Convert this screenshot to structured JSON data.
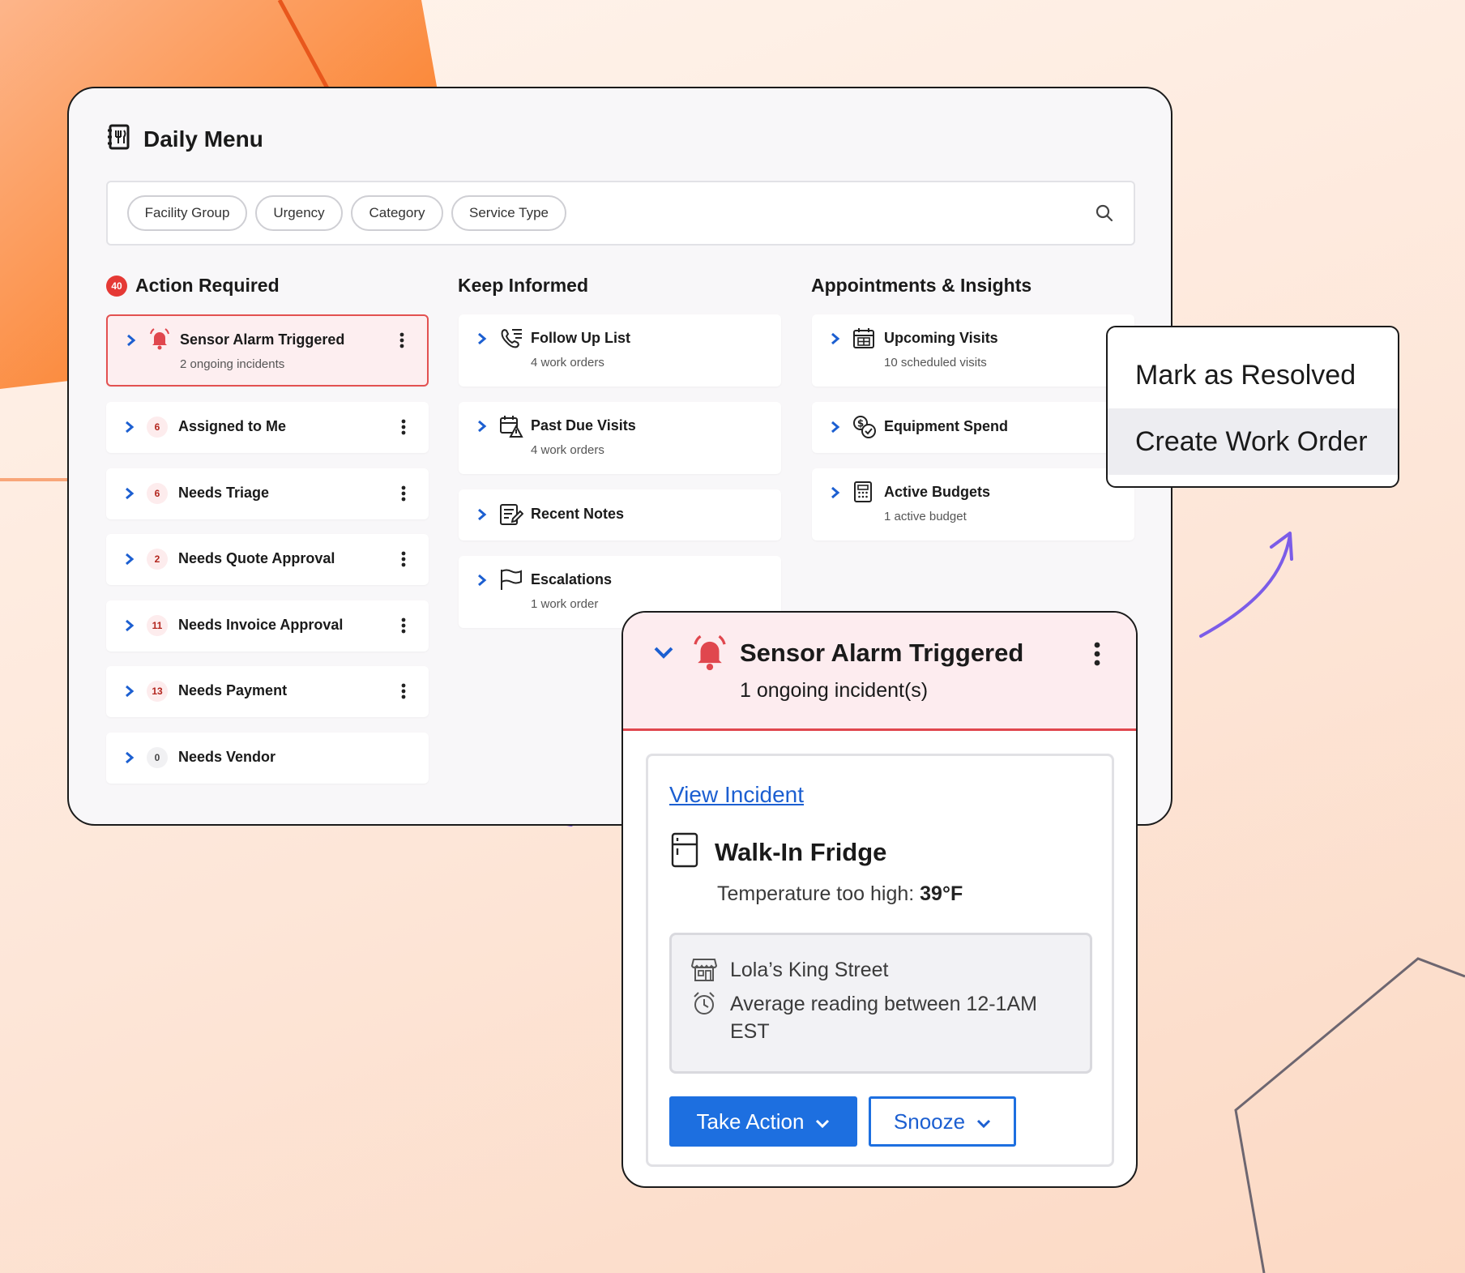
{
  "app": {
    "title": "Daily Menu"
  },
  "filters": [
    "Facility Group",
    "Urgency",
    "Category",
    "Service Type"
  ],
  "sections": {
    "action_required": {
      "title": "Action Required",
      "count": "40",
      "items": [
        {
          "label": "Sensor Alarm Triggered",
          "sub": "2 ongoing incidents"
        },
        {
          "label": "Assigned to Me",
          "count": "6"
        },
        {
          "label": "Needs Triage",
          "count": "6"
        },
        {
          "label": "Needs Quote Approval",
          "count": "2"
        },
        {
          "label": "Needs Invoice Approval",
          "count": "11"
        },
        {
          "label": "Needs Payment",
          "count": "13"
        },
        {
          "label": "Needs Vendor",
          "count": "0"
        }
      ]
    },
    "keep_informed": {
      "title": "Keep Informed",
      "items": [
        {
          "label": "Follow Up List",
          "sub": "4 work orders",
          "icon": "phone-list-icon"
        },
        {
          "label": "Past Due Visits",
          "sub": "4 work orders",
          "icon": "calendar-warning-icon"
        },
        {
          "label": "Recent Notes",
          "icon": "notes-icon"
        },
        {
          "label": "Escalations",
          "sub": "1 work order",
          "icon": "flag-icon"
        }
      ]
    },
    "appointments": {
      "title": "Appointments & Insights",
      "items": [
        {
          "label": "Upcoming Visits",
          "sub": "10 scheduled visits",
          "icon": "calendar-icon"
        },
        {
          "label": "Equipment Spend",
          "icon": "money-check-icon"
        },
        {
          "label": "Active Budgets",
          "sub": "1 active budget",
          "icon": "calculator-icon"
        }
      ]
    }
  },
  "context_menu": {
    "items": [
      "Mark as Resolved",
      "Create Work Order"
    ],
    "highlighted": "Create Work Order"
  },
  "detail": {
    "title": "Sensor Alarm Triggered",
    "subtitle": "1 ongoing incident(s)",
    "link": "View Incident",
    "equipment": "Walk-In Fridge",
    "temp_label": "Temperature too high:",
    "temp_value": "39°F",
    "location": "Lola’s King Street",
    "reading_line1": "Average reading between 12-1AM",
    "reading_line2": "EST",
    "primary_button": "Take Action",
    "secondary_button": "Snooze"
  },
  "colors": {
    "accent_blue": "#1d6fe0",
    "alert_red": "#e0474e",
    "badge_red": "#e53935",
    "arrow_purple": "#7b5ce8",
    "bg_orange": "#fb8a3c"
  }
}
